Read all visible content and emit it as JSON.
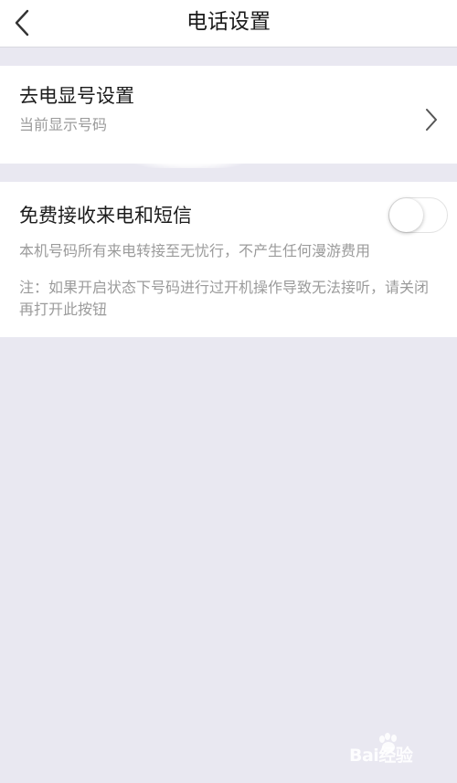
{
  "nav": {
    "title": "电话设置",
    "back_icon": "chevron-left-icon"
  },
  "caller_id": {
    "title": "去电显号设置",
    "subtitle": "当前显示号码",
    "chevron_icon": "chevron-right-icon"
  },
  "free_calls": {
    "title": "免费接收来电和短信",
    "toggle_state": "off",
    "description": "本机号码所有来电转接至无忧行，不产生任何漫游费用",
    "note": "注：如果开启状态下号码进行过开机操作导致无法接听，请关闭再打开此按钮"
  },
  "watermark": {
    "text": "Bai经验"
  },
  "colors": {
    "background": "#e9e8f1",
    "card": "#ffffff",
    "secondary_text": "#9b9b9b"
  }
}
